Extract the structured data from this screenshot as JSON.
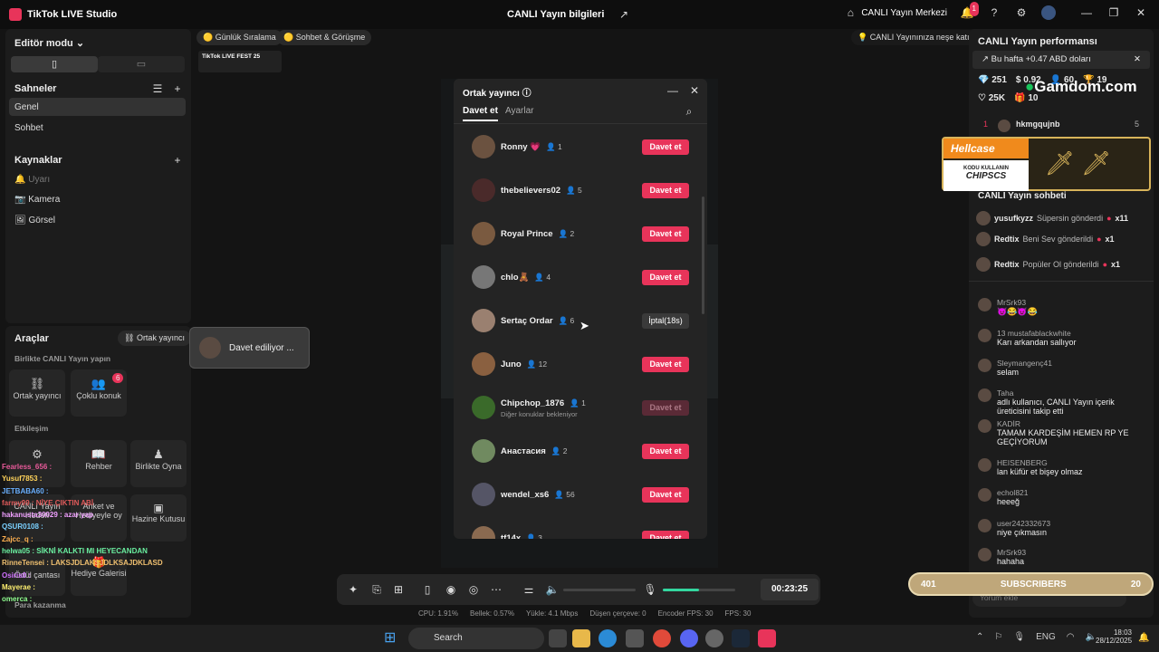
{
  "titlebar": {
    "app": "TikTok LIVE Studio",
    "center": "CANLI Yayın bilgileri",
    "live_center": "CANLI Yayın Merkezi",
    "notif_count": "1"
  },
  "left": {
    "mode": "Editör modu",
    "scenes_h": "Sahneler",
    "scenes": [
      "Genel",
      "Sohbet"
    ],
    "sources_h": "Kaynaklar",
    "sources": [
      "Uyarı",
      "Kamera",
      "Görsel"
    ],
    "tools_h": "Araçlar",
    "cohost_link": "Ortak yayıncı",
    "coop_h": "Birlikte CANLI Yayın yapın",
    "coop_tools": [
      "Ortak yayıncı",
      "Çoklu konuk"
    ],
    "multi_badge": "6",
    "inter_h": "Etkileşim",
    "inter_tools": [
      "Rehber",
      "Birlikte Oyna"
    ],
    "inter2": [
      "CANLI Yayın Hedefi",
      "Anket ve Hediyeyle oy",
      "Hazine Kutusu"
    ],
    "row3": [
      "Ödül çantası",
      "Hediye Galerisi"
    ],
    "earn_h": "Para kazanma"
  },
  "invite_popup": {
    "text": "Davet ediliyor ..."
  },
  "top_chips": [
    "Günlük Sıralama",
    "Sohbet & Görüşme"
  ],
  "fest_logo": "TikTok LIVE FEST 25",
  "top_right_tip": "CANLI Yayınınıza neşe katın",
  "dialog": {
    "title": "Ortak yayıncı",
    "tabs": [
      "Davet et",
      "Ayarlar"
    ],
    "rows": [
      {
        "name": "Ronny 💗",
        "count": "1",
        "btn": "Davet et",
        "state": "normal"
      },
      {
        "name": "thebelievers02",
        "count": "5",
        "btn": "Davet et",
        "state": "normal"
      },
      {
        "name": "Royal Prince",
        "count": "2",
        "btn": "Davet et",
        "state": "normal"
      },
      {
        "name": "chlo🧸",
        "count": "4",
        "btn": "Davet et",
        "state": "normal"
      },
      {
        "name": "Sertaç Ordar",
        "count": "6",
        "btn": "İptal(18s)",
        "state": "grey"
      },
      {
        "name": "Juno",
        "count": "12",
        "btn": "Davet et",
        "state": "normal"
      },
      {
        "name": "Chipchop_1876",
        "count": "1",
        "btn": "Davet et",
        "state": "dim",
        "sub": "Diğer konuklar bekleniyor"
      },
      {
        "name": "Анастасия",
        "count": "2",
        "btn": "Davet et",
        "state": "normal"
      },
      {
        "name": "wendel_xs6",
        "count": "56",
        "btn": "Davet et",
        "state": "normal"
      },
      {
        "name": "tf14x",
        "count": "3",
        "btn": "Davet et",
        "state": "normal"
      }
    ]
  },
  "right": {
    "perf_h": "CANLI Yayın performansı",
    "earn": "Bu hafta +0.47 ABD doları",
    "stats": [
      "251",
      "0.92",
      "60",
      "19",
      "25K",
      "10"
    ],
    "rank": {
      "pos": "1",
      "user": "hkmgqujnb",
      "val": "5"
    },
    "chat_h": "CANLI Yayın sohbeti",
    "gifts": [
      {
        "user": "yusufkyzz",
        "text": "Süpersin gönderdi",
        "mult": "x11"
      },
      {
        "user": "Redtix",
        "text": "Beni Sev gönderildi",
        "mult": "x1"
      },
      {
        "user": "Redtix",
        "text": "Popüler Ol gönderildi",
        "mult": "x1"
      }
    ],
    "chat": [
      {
        "u": "MrSrk93",
        "m": "😈😂😈😂"
      },
      {
        "u": "13  mustafablackwhite",
        "m": "Karı arkandan sallıyor"
      },
      {
        "u": "Sleymangenç41",
        "m": "selam"
      },
      {
        "u": "Taha",
        "m": "adlı kullanıcı, CANLI Yayın içerik üreticisini takip etti"
      },
      {
        "u": "KADİR",
        "m": "TAMAM KARDEŞİM HEMEN RP YE GEÇİYORUM"
      },
      {
        "u": "HEISENBERG",
        "m": "lan küfür et bişey olmaz"
      },
      {
        "u": "echol821",
        "m": "heeeğ"
      },
      {
        "u": "user242332673",
        "m": "niye çıkmasın"
      },
      {
        "u": "MrSrk93",
        "m": "hahaha"
      }
    ],
    "comment_ph": "Yorum ekle"
  },
  "gamdom": "Gamdom.com",
  "hellcase": {
    "brand": "Hellcase",
    "code_label": "KODU KULLANIN",
    "code": "CHIPSCS"
  },
  "subs": {
    "left": "401",
    "label": "SUBSCRIBERS",
    "right": "20"
  },
  "overlay_chat": [
    "Fearless_656 :",
    "Yusuf7853 :",
    "JETBABA60 :",
    "farmy99 : NİYE ÇIKTIN ABİ",
    "hakanusta30029 : azar yap",
    "QSUR0108 :",
    "Zajcc_q :",
    "helwa05 : SİKNİ KALKTI MI HEYECANDAN",
    "RinneTensei : LAKSJDLAKSJDLKSAJDKLASD",
    "Osiris0 :",
    "Mayerae :",
    "omerca :"
  ],
  "bottom": {
    "timer": "00:23:25"
  },
  "stats": [
    "CPU: 1.91%",
    "Bellek: 0.57%",
    "Yükle: 4.1 Mbps",
    "Düşen çerçeve: 0",
    "Encoder FPS: 30",
    "FPS: 30"
  ],
  "taskbar": {
    "search": "Search",
    "lang": "ENG",
    "time": "18:03",
    "date": "28/12/2025"
  }
}
